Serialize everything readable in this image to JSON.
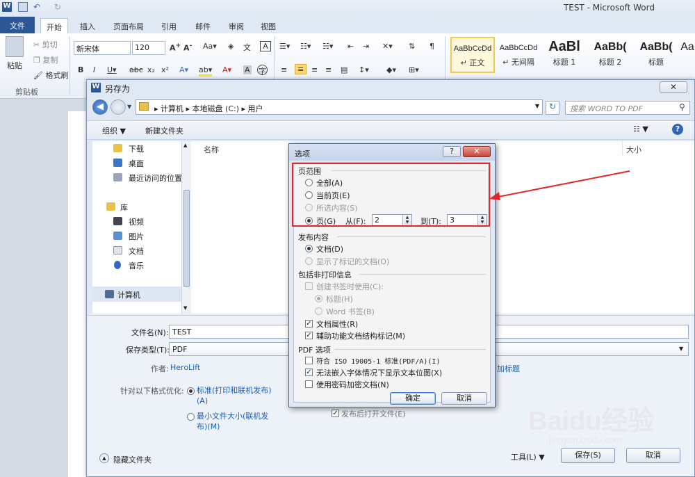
{
  "window": {
    "title": "TEST - Microsoft Word"
  },
  "tabs": [
    "文件",
    "开始",
    "插入",
    "页面布局",
    "引用",
    "邮件",
    "审阅",
    "视图"
  ],
  "clipboard": {
    "paste": "粘贴",
    "cut": "剪切",
    "copy": "复制",
    "format_painter": "格式刷",
    "group_label": "剪贴板"
  },
  "font": {
    "name": "新宋体",
    "size": "120"
  },
  "styles": [
    {
      "sample": "AaBbCcDd",
      "name": "↵ 正文"
    },
    {
      "sample": "AaBbCcDd",
      "name": "↵ 无间隔"
    },
    {
      "sample": "AaBl",
      "name": "标题 1"
    },
    {
      "sample": "AaBb(",
      "name": "标题 2"
    },
    {
      "sample": "AaBb(",
      "name": "标题"
    },
    {
      "sample": "Aa",
      "name": ""
    }
  ],
  "save_as": {
    "title": "另存为",
    "address": [
      "计算机",
      "本地磁盘 (C:)",
      "用户"
    ],
    "search_placeholder": "搜索 WORD TO PDF",
    "toolbar": {
      "organize": "组织 ▼",
      "new_folder": "新建文件夹"
    },
    "nav": [
      "下载",
      "桌面",
      "最近访问的位置",
      "库",
      "视频",
      "图片",
      "文档",
      "音乐",
      "计算机"
    ],
    "columns": {
      "name": "名称",
      "size": "大小"
    },
    "filename_label": "文件名(N):",
    "filename": "TEST",
    "filetype_label": "保存类型(T):",
    "filetype": "PDF",
    "author_label": "作者:",
    "author": "HeroLift",
    "add_tag": "加标题",
    "optimize_label": "针对以下格式优化:",
    "optimize_standard": "标准(打印和联机发布)(A)",
    "optimize_min": "最小文件大小(联机发布)(M)",
    "open_after": "发布后打开文件(E)",
    "hide_folders": "隐藏文件夹",
    "tools": "工具(L)",
    "save": "保存(S)",
    "cancel": "取消"
  },
  "options": {
    "title": "选项",
    "help": "?",
    "close": "✕",
    "page_range": {
      "heading": "页范围",
      "all": "全部(A)",
      "current": "当前页(E)",
      "selection": "所选内容(S)",
      "pages": "页(G)",
      "from_label": "从(F):",
      "from": "2",
      "to_label": "到(T):",
      "to": "3"
    },
    "publish": {
      "heading": "发布内容",
      "document": "文档(D)",
      "markup": "显示了标记的文档(O)"
    },
    "nonprint": {
      "heading": "包括非打印信息",
      "bookmarks": "创建书签时使用(C):",
      "headings": "标题(H)",
      "word_bookmarks": "Word 书签(B)",
      "properties": "文档属性(R)",
      "structure": "辅助功能文档结构标记(M)"
    },
    "pdf": {
      "heading": "PDF 选项",
      "iso": "符合 ISO 19005-1 标准(PDF/A)(I)",
      "bitmap": "无法嵌入字体情况下显示文本位图(X)",
      "encrypt": "使用密码加密文档(N)"
    },
    "ok": "确定",
    "cancel": "取消"
  },
  "watermark": "Baidu经验",
  "watermark_sub": "jingyan.baidu.com"
}
